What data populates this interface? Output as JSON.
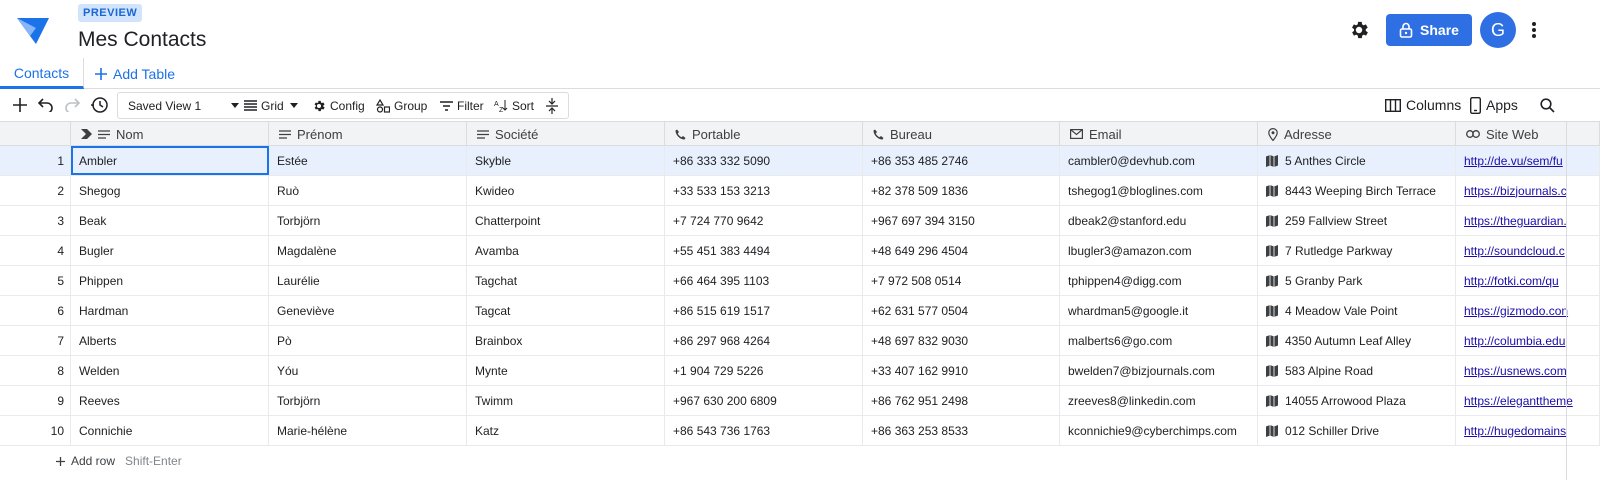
{
  "app": {
    "badge": "PREVIEW",
    "title": "Mes Contacts",
    "share_label": "Share",
    "avatar_letter": "G",
    "accent": "#1a73e8",
    "share_color": "#2f6fe4"
  },
  "tabs": {
    "items": [
      {
        "label": "Contacts"
      }
    ],
    "add_label": "Add Table"
  },
  "toolbar": {
    "saved_view": "Saved View 1",
    "grid": "Grid",
    "config": "Config",
    "group": "Group",
    "filter": "Filter",
    "sort": "Sort",
    "columns": "Columns",
    "apps": "Apps",
    "icons": [
      "plus-icon",
      "undo-icon",
      "redo-icon",
      "history-icon",
      "search-icon"
    ]
  },
  "grid": {
    "columns": [
      {
        "label": "Nom",
        "icon": "text-icon"
      },
      {
        "label": "Prénom",
        "icon": "text-icon"
      },
      {
        "label": "Société",
        "icon": "text-icon"
      },
      {
        "label": "Portable",
        "icon": "phone-icon"
      },
      {
        "label": "Bureau",
        "icon": "phone-icon"
      },
      {
        "label": "Email",
        "icon": "email-icon"
      },
      {
        "label": "Adresse",
        "icon": "location-icon"
      },
      {
        "label": "Site Web",
        "icon": "link-icon"
      }
    ],
    "rows": [
      {
        "n": "1",
        "nom": "Ambler",
        "prenom": "Estée",
        "societe": "Skyble",
        "portable": "+86 333 332 5090",
        "bureau": "+86 353 485 2746",
        "email": "cambler0@devhub.com",
        "adresse": "5 Anthes Circle",
        "site": "http://de.vu/sem/fu"
      },
      {
        "n": "2",
        "nom": "Shegog",
        "prenom": "Ruò",
        "societe": "Kwideo",
        "portable": "+33 533 153 3213",
        "bureau": "+82 378 509 1836",
        "email": "tshegog1@bloglines.com",
        "adresse": "8443 Weeping Birch Terrace",
        "site": "https://bizjournals.c"
      },
      {
        "n": "3",
        "nom": "Beak",
        "prenom": "Torbjörn",
        "societe": "Chatterpoint",
        "portable": "+7 724 770 9642",
        "bureau": "+967 697 394 3150",
        "email": "dbeak2@stanford.edu",
        "adresse": "259 Fallview Street",
        "site": "https://theguardian."
      },
      {
        "n": "4",
        "nom": "Bugler",
        "prenom": "Magdalène",
        "societe": "Avamba",
        "portable": "+55 451 383 4494",
        "bureau": "+48 649 296 4504",
        "email": "lbugler3@amazon.com",
        "adresse": "7 Rutledge Parkway",
        "site": "http://soundcloud.c"
      },
      {
        "n": "5",
        "nom": "Phippen",
        "prenom": "Laurélie",
        "societe": "Tagchat",
        "portable": "+66 464 395 1103",
        "bureau": "+7 972 508 0514",
        "email": "tphippen4@digg.com",
        "adresse": "5 Granby Park",
        "site": "http://fotki.com/qu"
      },
      {
        "n": "6",
        "nom": "Hardman",
        "prenom": "Geneviève",
        "societe": "Tagcat",
        "portable": "+86 515 619 1517",
        "bureau": "+62 631 577 0504",
        "email": "whardman5@google.it",
        "adresse": "4 Meadow Vale Point",
        "site": "https://gizmodo.con"
      },
      {
        "n": "7",
        "nom": "Alberts",
        "prenom": "Pò",
        "societe": "Brainbox",
        "portable": "+86 297 968 4264",
        "bureau": "+48 697 832 9030",
        "email": "malberts6@go.com",
        "adresse": "4350 Autumn Leaf Alley",
        "site": "http://columbia.edu"
      },
      {
        "n": "8",
        "nom": "Welden",
        "prenom": "Yóu",
        "societe": "Mynte",
        "portable": "+1 904 729 5226",
        "bureau": "+33 407 162 9910",
        "email": "bwelden7@bizjournals.com",
        "adresse": "583 Alpine Road",
        "site": "https://usnews.com"
      },
      {
        "n": "9",
        "nom": "Reeves",
        "prenom": "Torbjörn",
        "societe": "Twimm",
        "portable": "+967 630 200 6809",
        "bureau": "+86 762 951 2498",
        "email": "zreeves8@linkedin.com",
        "adresse": "14055 Arrowood Plaza",
        "site": "https://eleganttheme"
      },
      {
        "n": "10",
        "nom": "Connichie",
        "prenom": "Marie-hélène",
        "societe": "Katz",
        "portable": "+86 543 736 1763",
        "bureau": "+86 363 253 8533",
        "email": "kconnichie9@cyberchimps.com",
        "adresse": "012 Schiller Drive",
        "site": "http://hugedomains"
      }
    ],
    "add_row_label": "Add row",
    "add_row_hint": "Shift-Enter"
  }
}
